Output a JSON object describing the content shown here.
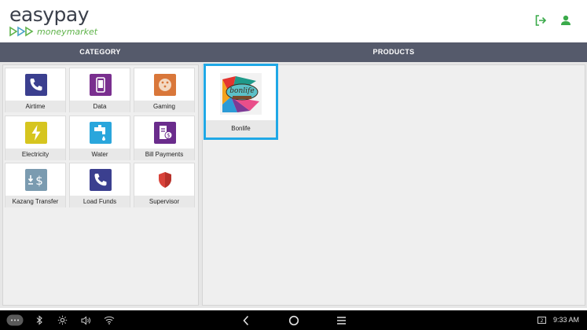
{
  "app": {
    "logo_main": "easypay",
    "logo_sub": "moneymarket",
    "brand_green": "#5fb34a",
    "header_icons": [
      "logout-icon",
      "user-icon"
    ]
  },
  "columns": {
    "category": "CATEGORY",
    "products": "PRODUCTS"
  },
  "categories": [
    {
      "label": "Airtime",
      "icon": "phone-icon",
      "color": "#3b3f8f"
    },
    {
      "label": "Data",
      "icon": "mobile-data-icon",
      "color": "#7a2f8f"
    },
    {
      "label": "Gaming",
      "icon": "dice-icon",
      "color": "#d9773a"
    },
    {
      "label": "Electricity",
      "icon": "lightning-icon",
      "color": "#d6c51f"
    },
    {
      "label": "Water",
      "icon": "water-tap-icon",
      "color": "#2aa6dc"
    },
    {
      "label": "Bill Payments",
      "icon": "bill-icon",
      "color": "#6a2c8c"
    },
    {
      "label": "Kazang Transfer",
      "icon": "transfer-icon",
      "color": "#7b9bb0"
    },
    {
      "label": "Load Funds",
      "icon": "phone-icon",
      "color": "#3b3f8f"
    },
    {
      "label": "Supervisor",
      "icon": "shield-icon",
      "color": "#d9433a"
    }
  ],
  "products": [
    {
      "label": "Bonlife",
      "image_text": "bonlife",
      "selected_color": "#1fa8e6"
    }
  ],
  "system_bar": {
    "time": "9:33 AM",
    "icons": [
      "more-icon",
      "bluetooth-icon",
      "brightness-icon",
      "volume-icon",
      "wifi-icon",
      "back-icon",
      "home-icon",
      "menu-icon",
      "screen-icon"
    ]
  }
}
